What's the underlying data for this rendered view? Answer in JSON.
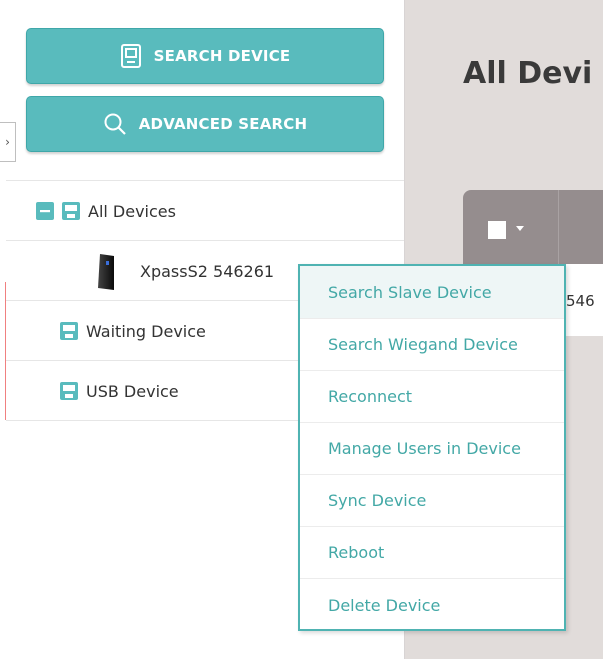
{
  "sidebar": {
    "search_device_label": "SEARCH DEVICE",
    "advanced_search_label": "ADVANCED SEARCH",
    "collapse_glyph": "›"
  },
  "tree": {
    "all_devices": "All Devices",
    "device_item": "XpassS2 546261",
    "waiting_device": "Waiting Device",
    "usb_device": "USB Device"
  },
  "main": {
    "title": "All Devi",
    "row_text": "546"
  },
  "context_menu": {
    "items": [
      {
        "label": "Search Slave Device"
      },
      {
        "label": "Search Wiegand Device"
      },
      {
        "label": "Reconnect"
      },
      {
        "label": "Manage Users in Device"
      },
      {
        "label": "Sync Device"
      },
      {
        "label": "Reboot"
      },
      {
        "label": "Delete Device"
      }
    ]
  },
  "colors": {
    "accent": "#59bbbd",
    "menu_text": "#43a8a6",
    "header_gray": "#958d8e",
    "main_bg": "#e1dcda"
  },
  "icons": {
    "search_device": "device-box-icon",
    "advanced_search": "magnifier-icon",
    "tree_collapse": "minus-square-icon",
    "tree_device": "floppy-icon",
    "device_thumb": "device-reader-icon"
  }
}
